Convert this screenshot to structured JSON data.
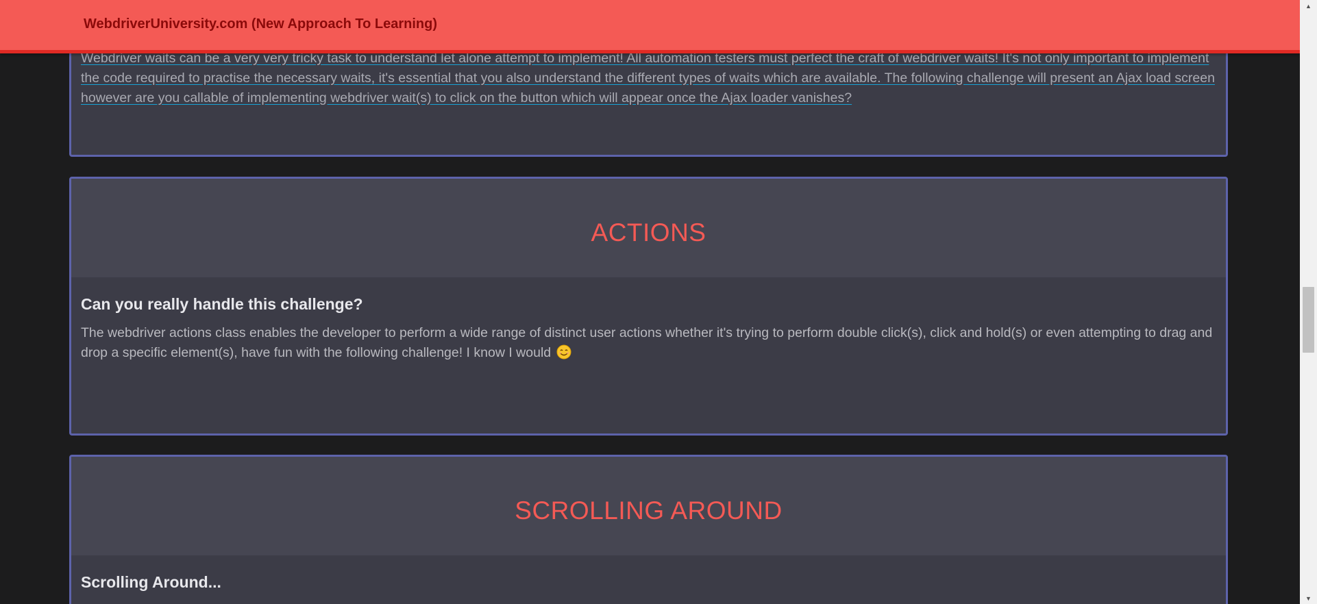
{
  "navbar": {
    "brand": "WebdriverUniversity.com (New Approach To Learning)"
  },
  "cards": {
    "waits": {
      "link_text": "Webdriver waits can be a very very tricky task to understand let alone attempt to implement! All automation testers must perfect the craft of webdriver waits! It's not only important to implement the code required to practise the necessary waits, it's essential that you also understand the different types of waits which are available. The following challenge will present an Ajax load screen however are you callable of implementing webdriver wait(s) to click on the button which will appear once the Ajax loader vanishes?"
    },
    "actions": {
      "header": "ACTIONS",
      "title": "Can you really handle this challenge?",
      "text": "The webdriver actions class enables the developer to perform a wide range of distinct user actions whether it's trying to perform double click(s), click and hold(s) or even attempting to drag and drop a specific element(s), have fun with the following challenge! I know I would",
      "emoji": "smiling-face-icon"
    },
    "scrolling": {
      "header": "SCROLLING AROUND",
      "title": "Scrolling Around..."
    }
  },
  "colors": {
    "navbar_bg": "#f45a55",
    "brand_text": "#8b0a0a",
    "card_border": "#5d63ab",
    "card_header_bg": "#464652",
    "card_body_bg": "#3c3c47",
    "heading_red": "#f45a55",
    "page_bg": "#1c1c1d",
    "link_underline": "#17a2d6"
  }
}
